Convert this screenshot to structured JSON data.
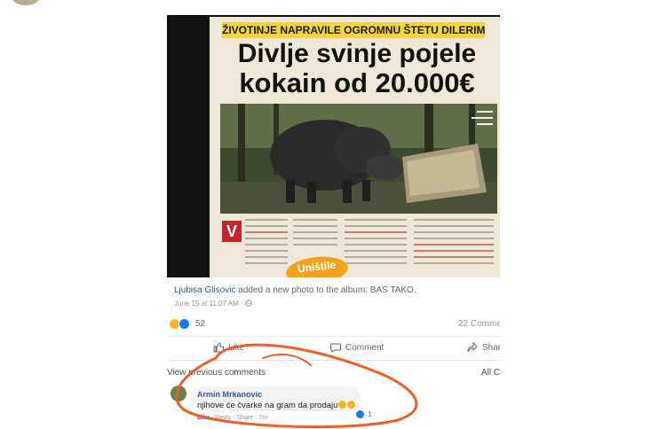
{
  "newspaper": {
    "kicker": "ŽIVOTINJE NAPRAVILE OGROMNU ŠTETU DILERIMA DROGE",
    "headline_line1": "Divlje svinje pojele",
    "headline_line2": "kokain od 20.000€",
    "dropcap": "V",
    "badge": "Uništile"
  },
  "post": {
    "author": "Ljubisa Glisovic",
    "action_text": " added a new photo to the album: ",
    "album": "BAS TAKO.",
    "date": "June 15 at 11:07 AM · "
  },
  "reactions": {
    "count": "52",
    "comments_count": "22 Comme"
  },
  "actions": {
    "like": "Like",
    "comment": "Comment",
    "share": "Shar"
  },
  "comments": {
    "view_previous": "View previous comments",
    "all_comments": "All C",
    "items": [
      {
        "author": "Armin Mrkanovic",
        "text": "njihove će čvarke na gram da prodaju",
        "reaction_count": "1",
        "actions": {
          "like": "Like",
          "reply": "· Reply",
          "share": "· Share",
          "time": "· 7m"
        }
      }
    ]
  },
  "colors": {
    "accent": "#385898",
    "annotation": "#e8622c",
    "kicker_bg": "#f1d53a"
  }
}
